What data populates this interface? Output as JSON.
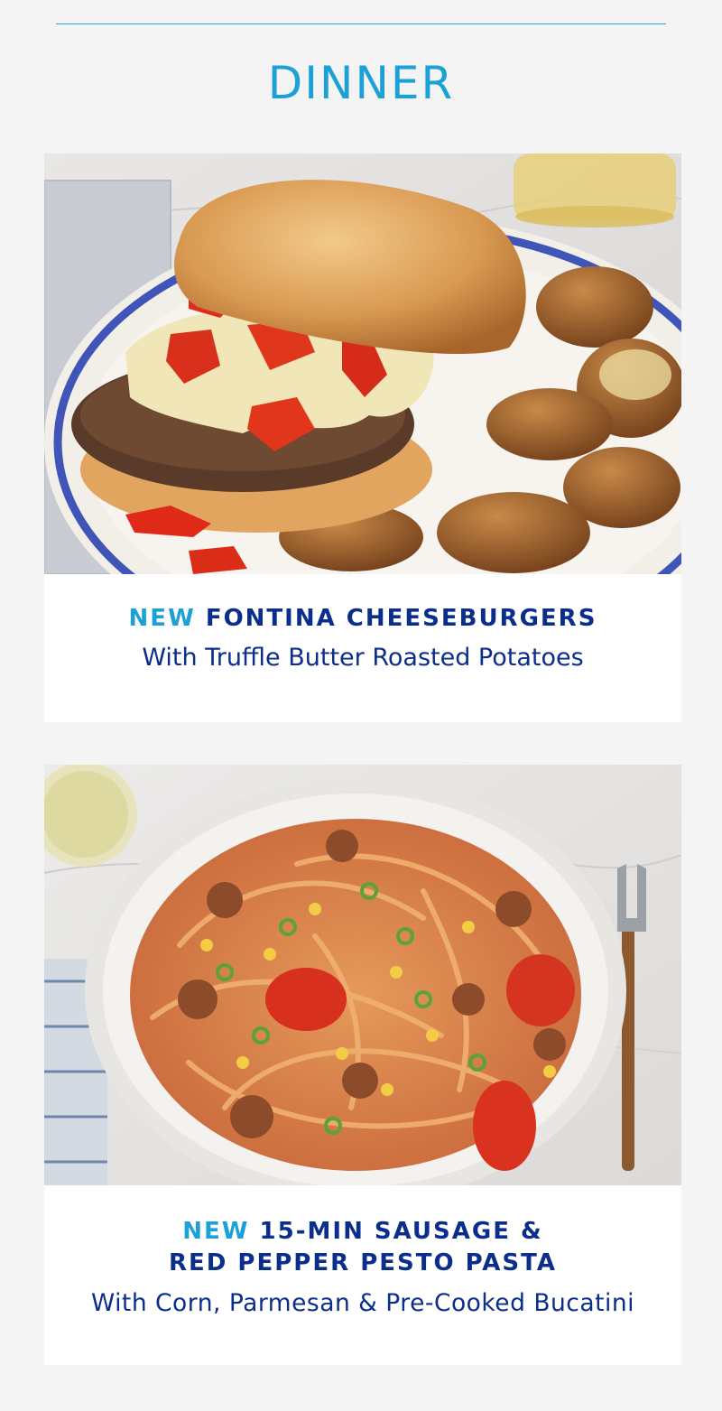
{
  "section": {
    "title": "DINNER"
  },
  "recipes": [
    {
      "badge": "NEW",
      "title_line1": "FONTINA CHEESEBURGERS",
      "title_line2": "",
      "subtitle": "With Truffle Butter Roasted Potatoes",
      "photo_subject": "cheeseburger-with-roasted-potatoes"
    },
    {
      "badge": "NEW",
      "title_line1": "15-MIN SAUSAGE &",
      "title_line2": "RED PEPPER PESTO PASTA",
      "subtitle": "With Corn, Parmesan & Pre-Cooked Bucatini",
      "photo_subject": "sausage-pesto-pasta-bowl"
    }
  ],
  "colors": {
    "accent": "#1ba0d8",
    "navy": "#0b2d8c",
    "page_bg": "#f4f4f4",
    "card_bg": "#ffffff"
  }
}
